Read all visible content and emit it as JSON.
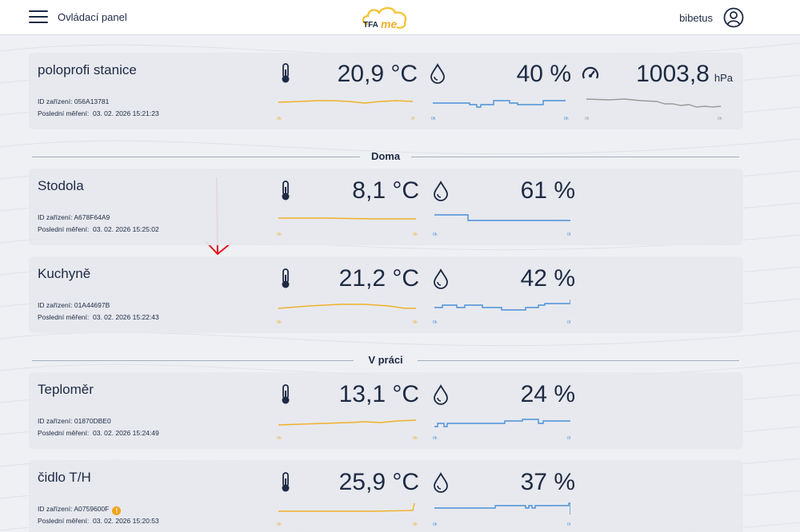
{
  "header": {
    "title": "Ovládací panel",
    "logo_text": "TFA me",
    "username": "bibetus"
  },
  "station": {
    "name": "poloprofi stanice",
    "id_label": "ID zařízení:",
    "id": "056A13781",
    "last_label": "Poslední měření:",
    "last": "03. 02. 2026 15:21:23",
    "temperature": "20,9 °C",
    "humidity": "40 %",
    "pressure_value": "1003,8",
    "pressure_unit": "hPa"
  },
  "groups": [
    {
      "name": "Doma",
      "devices": [
        {
          "name": "Stodola",
          "id": "A678F64A9",
          "last": "03. 02. 2026 15:25:02",
          "temperature": "8,1 °C",
          "humidity": "61 %"
        },
        {
          "name": "Kuchyně",
          "id": "01A44697B",
          "last": "03. 02. 2026 15:22:43",
          "temperature": "21,2 °C",
          "humidity": "42 %"
        }
      ]
    },
    {
      "name": "V práci",
      "devices": [
        {
          "name": "Teploměr",
          "id": "01870DBE0",
          "last": "03. 02. 2026 15:24:49",
          "temperature": "13,1 °C",
          "humidity": "24 %"
        },
        {
          "name": "čidlo T/H",
          "id": "A0759600F",
          "last": "03. 02. 2026 15:20:53",
          "temperature": "25,9 °C",
          "humidity": "37 %",
          "warning": true
        }
      ]
    }
  ],
  "labels": {
    "id_label": "ID zařízení:",
    "last_label": "Poslední měření:"
  },
  "colors": {
    "temperature_line": "#f0b02a",
    "humidity_line": "#4a90d9",
    "pressure_line": "#9a9a9a",
    "accent_warning": "#f2a21c",
    "annotation_arrow": "#e0141e"
  }
}
